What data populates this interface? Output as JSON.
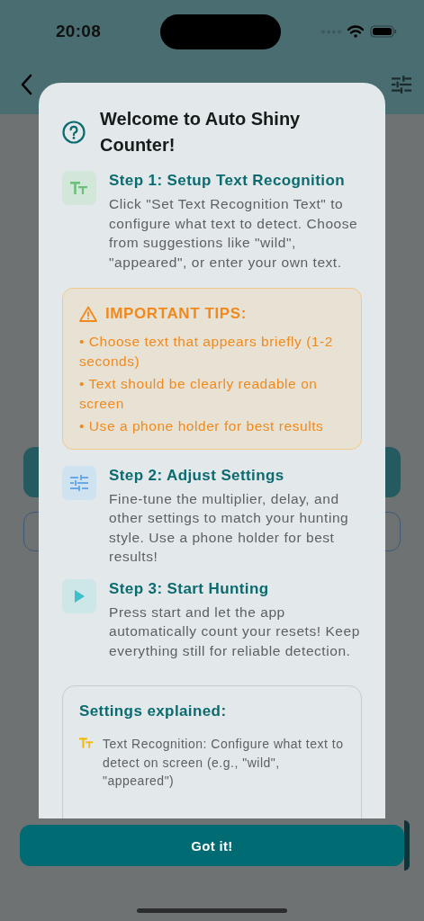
{
  "status_bar": {
    "time": "20:08"
  },
  "dialog": {
    "title": "Welcome to Auto Shiny Counter!",
    "steps": [
      {
        "kind": "text",
        "title": "Step 1: Setup Text Recognition",
        "body": "Click \"Set Text Recognition Text\" to configure what text to detect. Choose from suggestions like \"wild\", \"appeared\", or enter your own text."
      },
      {
        "kind": "tips",
        "title": "IMPORTANT TIPS:",
        "items": [
          "• Choose text that appears briefly (1-2 seconds)",
          "• Text should be clearly readable on screen",
          "• Use a phone holder for best results"
        ]
      },
      {
        "kind": "settings",
        "title": "Step 2: Adjust Settings",
        "body": "Fine-tune the multiplier, delay, and other settings to match your hunting style. Use a phone holder for best results!"
      },
      {
        "kind": "play",
        "title": "Step 3: Start Hunting",
        "body": "Press start and let the app automatically count your resets! Keep everything still for reliable detection."
      }
    ],
    "settings_explained": {
      "title": "Settings explained:",
      "items": [
        {
          "kind": "text",
          "text": "Text Recognition: Configure what text to detect on screen (e.g., \"wild\", \"appeared\")"
        }
      ]
    },
    "button": "Got it!"
  }
}
